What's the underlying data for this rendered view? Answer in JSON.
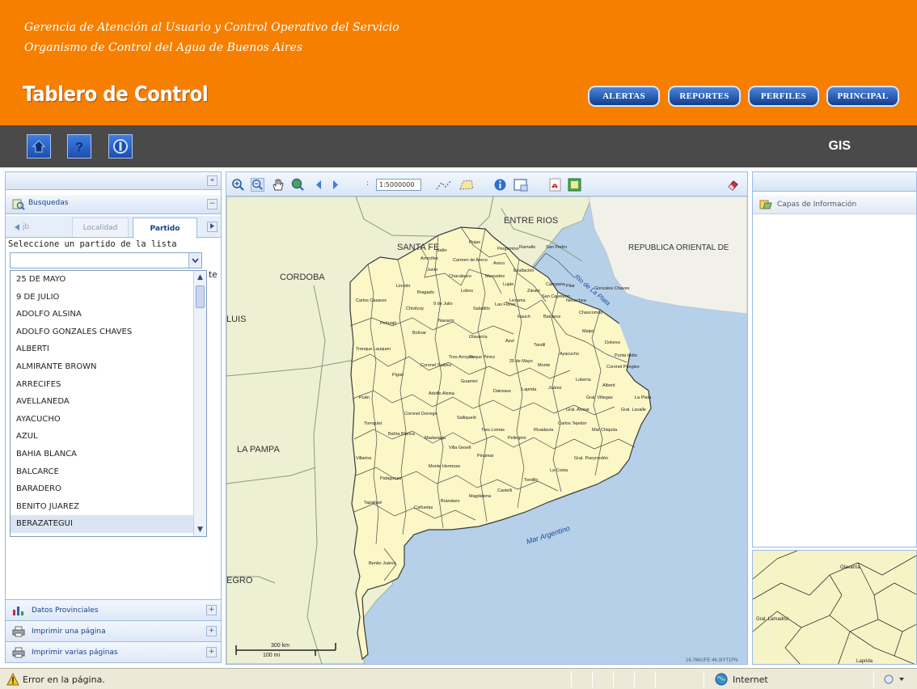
{
  "header": {
    "org_line1": "Gerencia de Atención al Usuario y Control Operativo del Servicio",
    "org_line2": "Organismo de Control del Agua de Buenos Aires",
    "app_title": "Tablero de Control",
    "nav_buttons": [
      "ALERTAS",
      "REPORTES",
      "PERFILES",
      "PRINCIPAL"
    ]
  },
  "toolbar": {
    "icons": [
      "home-icon",
      "help-icon",
      "info-icon"
    ],
    "section_label": "GIS"
  },
  "left_panel": {
    "collapse_label": "«",
    "search_header": "Busquedas",
    "tabs": [
      "Localidad",
      "Partido"
    ],
    "active_tab": "Partido",
    "tab_cut_left": "jb",
    "tab_cut_right": "te",
    "instruction": "Seleccione un partido de la lista",
    "select_value": "",
    "partidos": [
      "25 DE MAYO",
      "9 DE JULIO",
      "ADOLFO ALSINA",
      "ADOLFO GONZALES CHAVES",
      "ALBERTI",
      "ALMIRANTE BROWN",
      "ARRECIFES",
      "AVELLANEDA",
      "AYACUCHO",
      "AZUL",
      "BAHIA BLANCA",
      "BALCARCE",
      "BARADERO",
      "BENITO JUAREZ",
      "BERAZATEGUI"
    ],
    "selected_index": 14,
    "bottom_items": [
      "Datos Provinciales",
      "Imprimir una página",
      "Imprimir varias páginas"
    ]
  },
  "map": {
    "scale_value": "1:5000000",
    "labels": {
      "entre_rios": "ENTRE RIOS",
      "santa_fe": "SANTA FE",
      "cordoba": "CORDOBA",
      "la_pampa": "LA PAMPA",
      "uruguay": "REPUBLICA ORIENTAL DE",
      "luis": "LUIS",
      "negro": "EGRO",
      "rio_plata": "Rio de La Plata",
      "mar": "Mar Argentino"
    },
    "partido_labels": [
      "Rojas",
      "Pergamino",
      "Ramallo",
      "San Pedro",
      "Junín",
      "Chacabuco",
      "Lincoln",
      "Bragado",
      "9 de Julio",
      "Carlos Casares",
      "Pehuajó",
      "Trenque Lauquen",
      "Bolívar",
      "Olavarría",
      "Azul",
      "Tandil",
      "Ayacucho",
      "Maipú",
      "Dolores",
      "Chascomús",
      "Lobos",
      "Saladillo",
      "Las Flores",
      "Rauch",
      "Balcarce",
      "Necochea",
      "Tres Arroyos",
      "Coronel Suárez",
      "Pigüé",
      "Puán",
      "Tornquist",
      "Bahía Blanca",
      "Villarino",
      "Patagones",
      "Adolfo Alsina",
      "Guaminí",
      "Daireaux",
      "Laprida",
      "Juárez",
      "Lobería",
      "Coronel Pringles",
      "Gral. Lavalle",
      "Mar Chiquita",
      "Gral. Pueyrredón",
      "La Costa",
      "Tordillo",
      "Castelli",
      "Magdalena",
      "Brandsen",
      "Cañuelas",
      "Mercedes",
      "Luján",
      "Zárate",
      "Campana",
      "Pilar",
      "Exaltación",
      "Areco",
      "Carmen de Areco",
      "Salto",
      "Arrecifes",
      "Pinamar",
      "Villa Gesell",
      "Madariaga",
      "Coronel Dorrego",
      "Monte Hermoso",
      "Salliqueló",
      "Tres Lomas",
      "Pellegrini",
      "Rivadavia",
      "Carlos Tejedor",
      "Gral. Villegas",
      "Alberti",
      "Chivilcoy",
      "Navarro",
      "25 de Mayo",
      "Roque Pérez",
      "Monte",
      "Gral. Alvear",
      "Tapalqué",
      "Benito Juárez",
      "Gonzales Chaves",
      "San Cayetano",
      "Lezama",
      "Punta Indio",
      "La Plata"
    ],
    "coords_text": "16.766UFE 46.3IYT1FN",
    "scalebar_top": "300 km",
    "scalebar_bottom": "100 mi"
  },
  "right_panel": {
    "layers_header": "Capas de Información",
    "overview_labels": [
      "Olavarría",
      "Gral. Lamadrid",
      "Laprida"
    ]
  },
  "statusbar": {
    "message": "Error en la página.",
    "zone": "Internet"
  },
  "colors": {
    "header_orange": "#f77f00",
    "toolbar_dark": "#4a4a4a",
    "button_blue": "#1d4fb0",
    "land": "#fbf7c6",
    "neighbor_land": "#eef0d4",
    "water": "#b5d0e8"
  }
}
